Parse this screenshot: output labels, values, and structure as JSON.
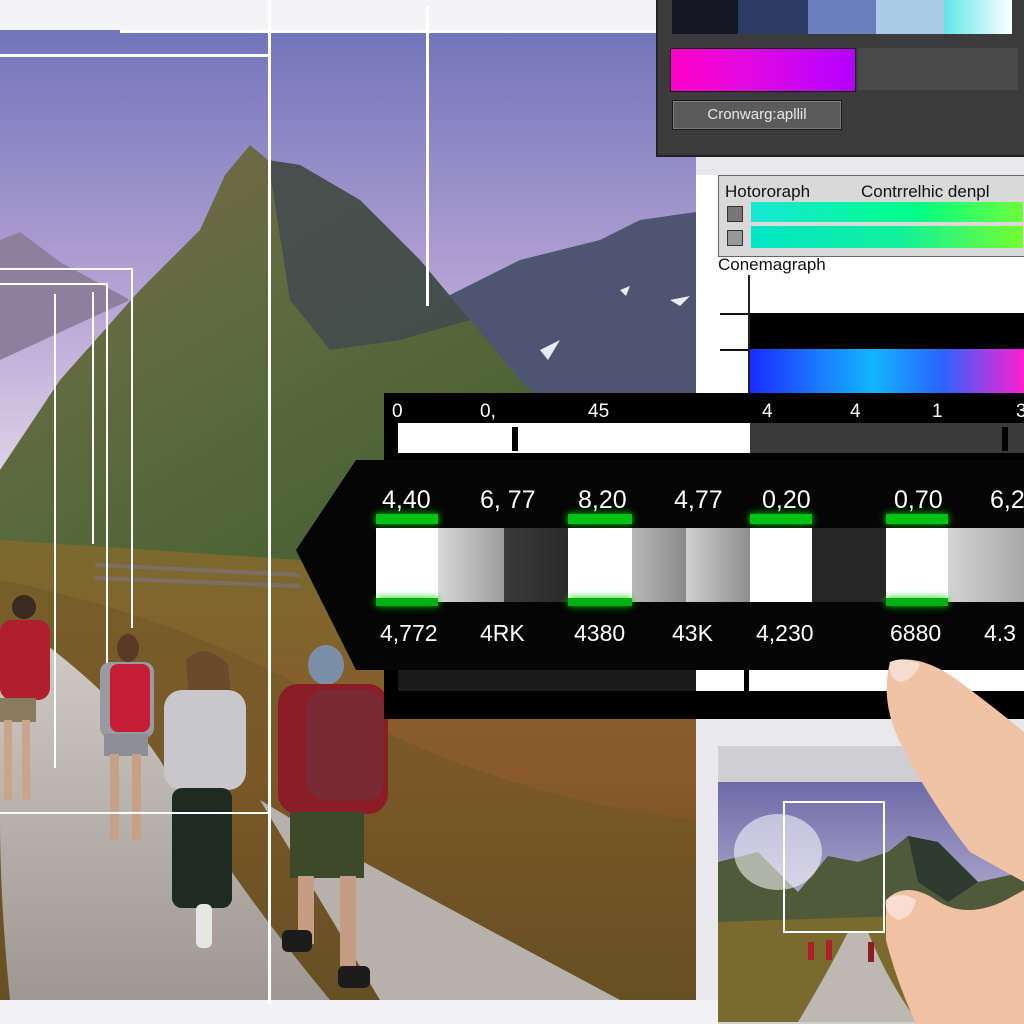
{
  "colors": {
    "panel_dark": "#3b3b3b",
    "accent_magenta": "#e30ae0",
    "accent_cyan": "#19e6d6",
    "highlight_green": "#00c214"
  },
  "tool_panel": {
    "button_label": "Cronwarg:apllil"
  },
  "layers_panel": {
    "title_left": "Hotororaph",
    "title_right": "Contrrelhic denpl",
    "footer_label": "Conemagraph"
  },
  "timeline": {
    "scale_labels": [
      "0",
      "0,",
      "45",
      "4",
      "4",
      "1",
      "3"
    ]
  },
  "value_strip": {
    "top_values": [
      "4,40",
      "6, 77",
      "8,20",
      "4,77",
      "0,20",
      "0,70",
      "6,2"
    ],
    "bottom_values": [
      "4,772",
      "4RK",
      "4380",
      "43K",
      "4,230",
      "6880",
      "4.3"
    ]
  },
  "icons": [
    "hand-pointer-icon",
    "hand-pointer-icon-secondary"
  ]
}
